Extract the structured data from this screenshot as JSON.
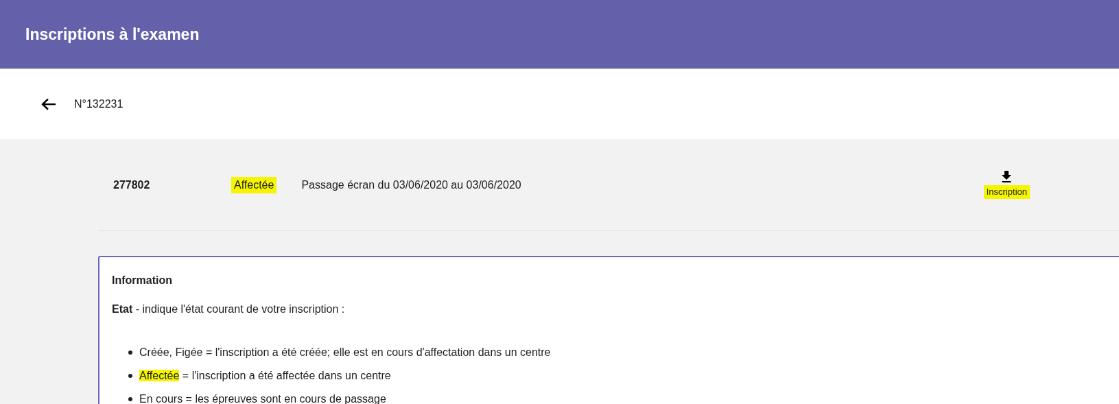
{
  "header": {
    "title": "Inscriptions à l'examen"
  },
  "subheader": {
    "reference": "N°132231"
  },
  "registration": {
    "number": "277802",
    "status": {
      "label": "Affectée",
      "highlighted": true
    },
    "description": "Passage écran du 03/06/2020 au 03/06/2020",
    "download": {
      "label": "Inscription",
      "highlighted": true
    }
  },
  "info": {
    "title": "Information",
    "intro_term": "Etat",
    "intro_text": " - indique l'état courant de votre inscription :",
    "bullets": [
      {
        "text": "Créée, Figée = l'inscription a été créée; elle est en cours d'affectation dans un centre"
      },
      {
        "marked": "Affectée",
        "text": " = l'inscription a été affectée dans un centre"
      },
      {
        "text": "En cours = les épreuves sont en cours de passage"
      }
    ]
  }
}
